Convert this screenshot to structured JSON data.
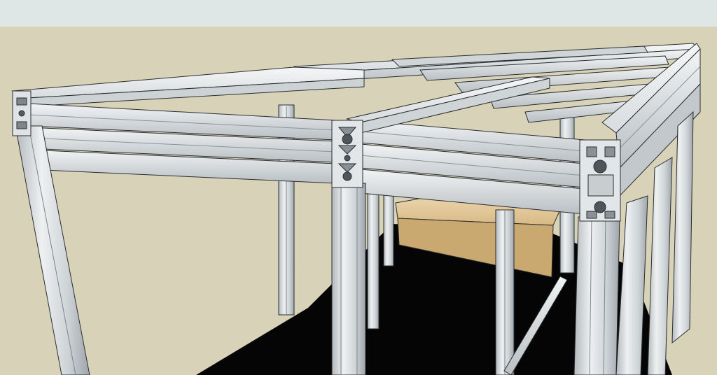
{
  "scene": {
    "subject": "aluminum-extrusion-frame",
    "colors": {
      "sky": "#dfe7e6",
      "ground": "#d8d3b8",
      "shadow": "#050505",
      "metal_light": "#e8ebed",
      "metal_mid": "#c9ced2",
      "metal_dark": "#9aa1a6",
      "outline": "#2a2d30",
      "wood": "#e2c99c"
    }
  }
}
